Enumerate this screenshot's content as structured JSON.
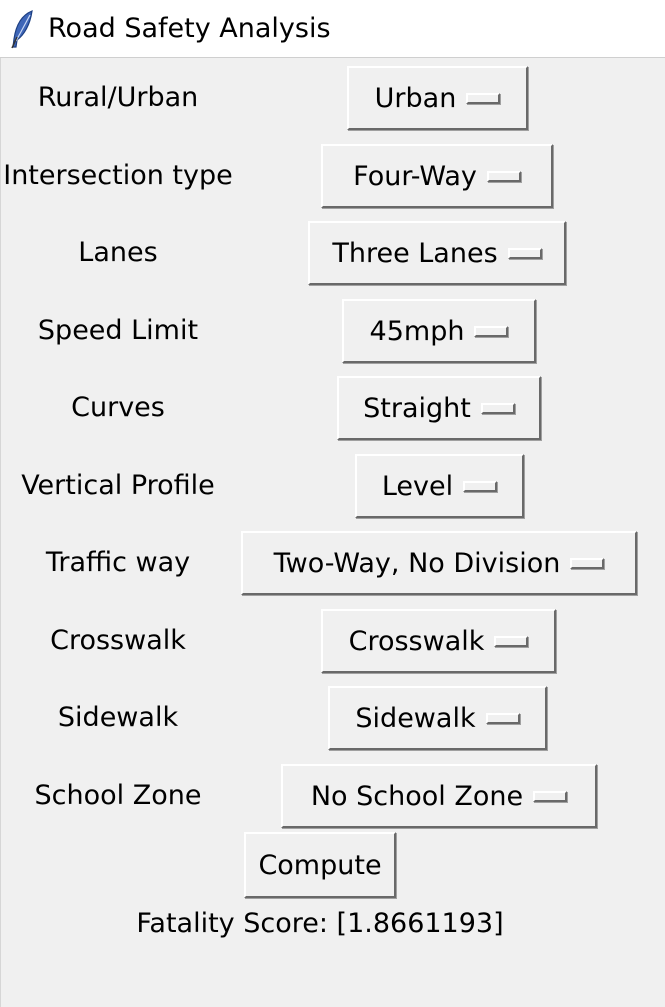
{
  "window": {
    "title": "Road Safety Analysis",
    "icon": "feather-icon"
  },
  "fields": [
    {
      "label": "Rural/Urban",
      "value": "Urban"
    },
    {
      "label": "Intersection type",
      "value": "Four-Way"
    },
    {
      "label": "Lanes",
      "value": "Three Lanes"
    },
    {
      "label": "Speed Limit",
      "value": "45mph"
    },
    {
      "label": "Curves",
      "value": "Straight"
    },
    {
      "label": "Vertical Profile",
      "value": "Level"
    },
    {
      "label": "Traffic way",
      "value": "Two-Way, No Division"
    },
    {
      "label": "Crosswalk",
      "value": "Crosswalk"
    },
    {
      "label": "Sidewalk",
      "value": "Sidewalk"
    },
    {
      "label": "School Zone",
      "value": "No School Zone"
    }
  ],
  "compute_label": "Compute",
  "result_text": "Fatality Score: [1.8661193]"
}
